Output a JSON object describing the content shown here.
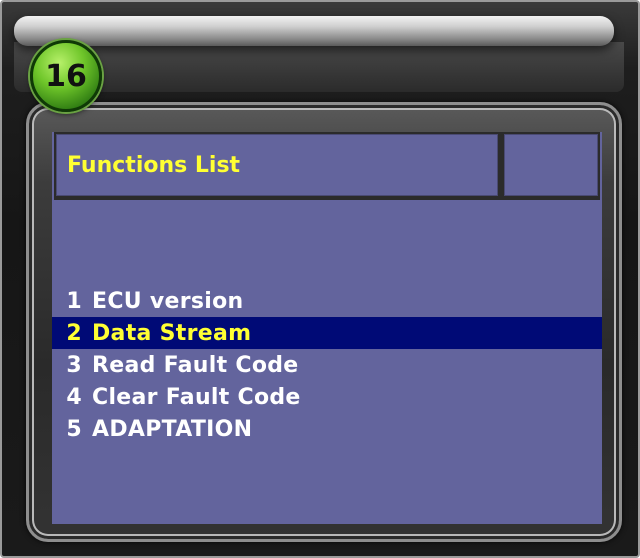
{
  "step_badge": "16",
  "panel": {
    "title": "Functions List"
  },
  "menu": {
    "items": [
      {
        "number": "1",
        "label": "ECU version"
      },
      {
        "number": "2",
        "label": "Data Stream"
      },
      {
        "number": "3",
        "label": "Read Fault Code"
      },
      {
        "number": "4",
        "label": "Clear Fault Code"
      },
      {
        "number": "5",
        "label": "ADAPTATION"
      }
    ],
    "selected_number": "2"
  },
  "colors": {
    "screen_bg": "#63649d",
    "selection_bg": "#000a76",
    "title_text": "#ffff33",
    "selected_text": "#ffff33",
    "item_text": "#ffffff",
    "badge": "#4ea61c"
  }
}
